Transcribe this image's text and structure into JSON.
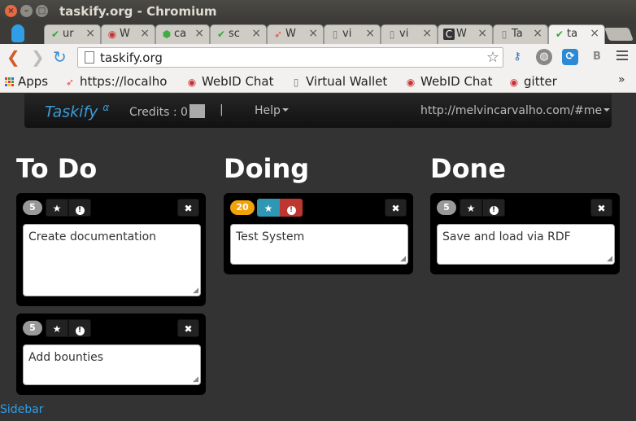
{
  "window": {
    "title": "taskify.org - Chromium",
    "controls": {
      "close": "×",
      "minimize": "–",
      "maximize": "□"
    }
  },
  "tabs": [
    {
      "label": "ur",
      "icon": "checkmark-icon"
    },
    {
      "label": "W",
      "icon": "webid-chat-icon"
    },
    {
      "label": "ca",
      "icon": "cube-icon"
    },
    {
      "label": "sc",
      "icon": "checkmark-icon"
    },
    {
      "label": "W",
      "icon": "rocket-icon"
    },
    {
      "label": "vi",
      "icon": "page-icon"
    },
    {
      "label": "vi",
      "icon": "page-icon"
    },
    {
      "label": "W",
      "icon": "c-icon"
    },
    {
      "label": "Ta",
      "icon": "page-icon"
    },
    {
      "label": "ta",
      "icon": "checkmark-icon",
      "active": true
    }
  ],
  "toolbar": {
    "url": "taskify.org"
  },
  "bookmarks": [
    {
      "label": "Apps",
      "icon": "apps-grid-icon"
    },
    {
      "label": "https://localho",
      "icon": "rocket-icon"
    },
    {
      "label": "WebID Chat",
      "icon": "webid-chat-icon"
    },
    {
      "label": "Virtual Wallet",
      "icon": "page-icon"
    },
    {
      "label": "WebID Chat",
      "icon": "webid-chat-icon"
    },
    {
      "label": "gitter",
      "icon": "gitter-icon"
    }
  ],
  "bookmarks_more": "»",
  "navbar": {
    "brand": "Taskify",
    "brand_sup": "α",
    "credits": "Credits : 0",
    "separator": "|",
    "help": "Help",
    "user": "http://melvincarvalho.com/#me"
  },
  "columns": [
    {
      "title": "To Do"
    },
    {
      "title": "Doing"
    },
    {
      "title": "Done"
    }
  ],
  "cards": {
    "todo1": {
      "bounty": "5",
      "text": "Create documentation"
    },
    "todo2": {
      "bounty": "5",
      "text": "Add bounties"
    },
    "doing1": {
      "bounty": "20",
      "text": "Test System"
    },
    "done1": {
      "bounty": "5",
      "text": "Save and load via RDF"
    }
  },
  "colors": {
    "bounty_default": "#999999",
    "bounty_active": "#f0a30a",
    "star_active": "#2f96b4",
    "priority_active": "#bd362f",
    "brand": "#3a9bd9"
  },
  "sidebar_link": "Sidebar"
}
